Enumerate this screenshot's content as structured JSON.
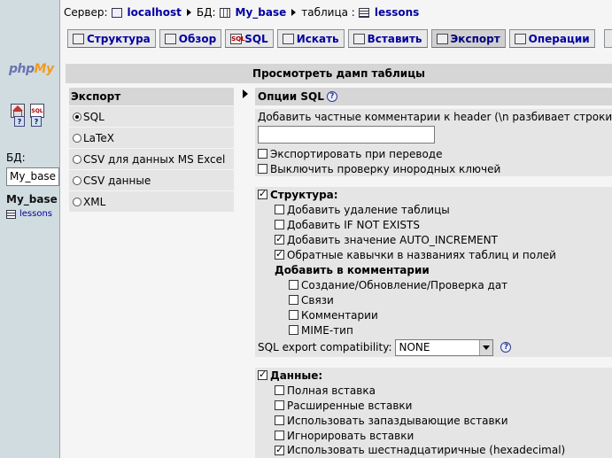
{
  "left_nav": {
    "logo_php": "php",
    "logo_my": "My",
    "db_label": "БД:",
    "db_select_value": "My_base",
    "db_name": "My_base",
    "table_name": "lessons"
  },
  "breadcrumb": {
    "server_label": "Сервер:",
    "server_value": "localhost",
    "db_label": "БД:",
    "db_value": "My_base",
    "table_label": "таблица :",
    "table_value": "lessons"
  },
  "tabs": [
    {
      "label": "Структура",
      "icon": "structure-icon"
    },
    {
      "label": "Обзор",
      "icon": "browse-icon"
    },
    {
      "label": "SQL",
      "icon": "sql-icon"
    },
    {
      "label": "Искать",
      "icon": "search-icon"
    },
    {
      "label": "Вставить",
      "icon": "insert-icon"
    },
    {
      "label": "Экспорт",
      "icon": "export-icon"
    },
    {
      "label": "Операции",
      "icon": "operations-icon"
    }
  ],
  "page_title": "Просмотреть дамп таблицы",
  "export": {
    "heading": "Экспорт",
    "options": [
      "SQL",
      "LaTeX",
      "CSV для данных MS Excel",
      "CSV данные",
      "XML"
    ],
    "selected": "SQL"
  },
  "sql_options": {
    "heading": "Опции SQL",
    "comment_label": "Добавить частные комментарии к header (\\n разбивает строки):",
    "comment_value": "",
    "export_in_transaction": "Экспортировать при переводе",
    "disable_fk_checks": "Выключить проверку инородных ключей",
    "structure": {
      "label": "Структура:",
      "drop_table": "Добавить удаление таблицы",
      "if_not_exists": "Добавить IF NOT EXISTS",
      "auto_increment": "Добавить значение AUTO_INCREMENT",
      "backquotes": "Обратные кавычки в названиях таблиц и полей",
      "comments_heading": "Добавить в комментарии",
      "dates": "Создание/Обновление/Проверка дат",
      "relations": "Связи",
      "comments": "Комментарии",
      "mime": "MIME-тип"
    },
    "compat_label": "SQL export compatibility:",
    "compat_value": "NONE",
    "data": {
      "label": "Данные:",
      "complete_inserts": "Полная вставка",
      "extended_inserts": "Расширенные вставки",
      "delayed_inserts": "Использовать запаздывающие вставки",
      "ignore_inserts": "Игнорировать вставки",
      "hex_binary": "Использовать шестнадцатиричные (hexadecimal) бинарные поля"
    }
  },
  "colors": {
    "link": "#0000a0",
    "panel": "#e5e5e5",
    "header": "#d6d6d6",
    "nav_bg": "#d0dce0"
  }
}
